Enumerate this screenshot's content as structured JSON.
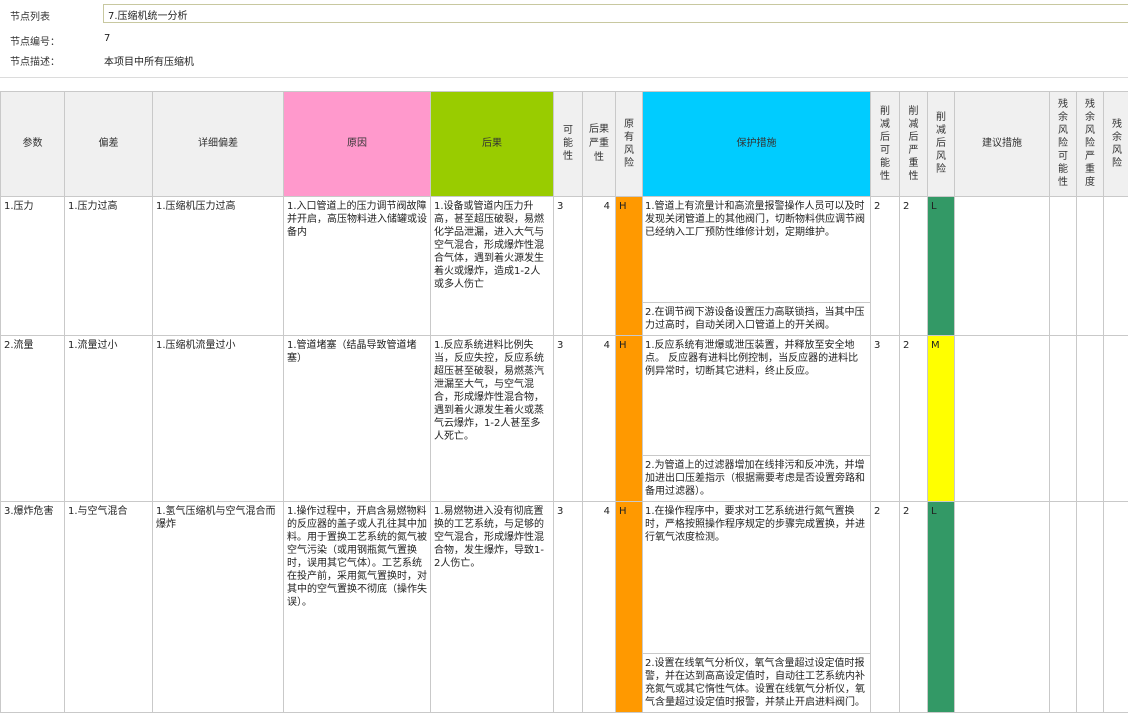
{
  "header": {
    "node_list_label": "节点列表",
    "node_list_value": "7.压缩机统一分析",
    "node_no_label": "节点编号：",
    "node_no_value": "7",
    "node_desc_label": "节点描述：",
    "node_desc_value": "本项目中所有压缩机"
  },
  "columns": {
    "param": "参数",
    "deviation": "偏差",
    "detail": "详细偏差",
    "cause": "原因",
    "consequence": "后果",
    "likelihood": "可能性",
    "severity": "后果严重性",
    "risk": "原有风险",
    "protection": "保护措施",
    "red_likelihood": "削减后可能性",
    "red_severity": "削减后严重性",
    "red_risk": "削减后风险",
    "recommendation": "建议措施",
    "res_likelihood": "残余风险可能性",
    "res_severity": "残余风险严重度",
    "res_risk": "残余风险"
  },
  "colors": {
    "cause_header": "#ff99cc",
    "consequence_header": "#99cc00",
    "protection_header": "#00ccff",
    "risk_H": "#ff9900",
    "risk_L": "#339966",
    "risk_M": "#ffff00"
  },
  "rows": [
    {
      "param": "1.压力",
      "deviation": "1.压力过高",
      "detail": "1.压缩机压力过高",
      "cause": "1.入口管道上的压力调节阀故障并开启，高压物料进入储罐或设备内",
      "consequence": "1.设备或管道内压力升高，甚至超压破裂，易燃化学品泄漏，进入大气与空气混合，形成爆炸性混合气体，遇到着火源发生着火或爆炸，造成1-2人或多人伤亡",
      "likelihood": "3",
      "severity": "4",
      "risk": "H",
      "protection_1": "1.管道上有流量计和高流量报警操作人员可以及时发现关闭管道上的其他阀门，切断物料供应调节阀已经纳入工厂预防性维修计划，定期维护。",
      "protection_2": "2.在调节阀下游设备设置压力高联锁挡，当其中压力过高时，自动关闭入口管道上的开关阀。",
      "red_likelihood": "2",
      "red_severity": "2",
      "red_risk": "L"
    },
    {
      "param": "2.流量",
      "deviation": "1.流量过小",
      "detail": "1.压缩机流量过小",
      "cause": "1.管道堵塞（结晶导致管道堵塞）",
      "consequence": "1.反应系统进料比例失当，反应失控，反应系统超压甚至破裂，易燃蒸汽泄漏至大气，与空气混合，形成爆炸性混合物，遇到着火源发生着火或蒸气云爆炸，1-2人甚至多人死亡。",
      "likelihood": "3",
      "severity": "4",
      "risk": "H",
      "protection_1": "1.反应系统有泄爆或泄压装置，并释放至安全地点。 反应器有进料比例控制，当反应器的进料比例异常时，切断其它进料，终止反应。",
      "protection_2": "2.为管道上的过滤器增加在线排污和反冲洗，并增加进出口压差指示（根据需要考虑是否设置旁路和备用过滤器）。",
      "red_likelihood": "3",
      "red_severity": "2",
      "red_risk": "M"
    },
    {
      "param": "3.爆炸危害",
      "deviation": "1.与空气混合",
      "detail": "1.氢气压缩机与空气混合而爆炸",
      "cause": "1.操作过程中，开启含易燃物料的反应器的盖子或人孔往其中加料。用于置换工艺系统的氮气被空气污染（或用钢瓶氮气置换时，误用其它气体）。工艺系统在投产前，采用氮气置换时，对其中的空气置换不彻底（操作失误）。",
      "consequence": "1.易燃物进入没有彻底置换的工艺系统，与足够的空气混合，形成爆炸性混合物，发生爆炸，导致1-2人伤亡。",
      "likelihood": "3",
      "severity": "4",
      "risk": "H",
      "protection_1": "1.在操作程序中，要求对工艺系统进行氮气置换时，严格按照操作程序规定的步骤完成置换，并进行氧气浓度检测。",
      "protection_2": "2.设置在线氧气分析仪，氧气含量超过设定值时报警，并在达到高高设定值时，自动往工艺系统内补充氮气或其它惰性气体。设置在线氧气分析仪，氧气含量超过设定值时报警，并禁止开启进料阀门。",
      "red_likelihood": "2",
      "red_severity": "2",
      "red_risk": "L"
    }
  ]
}
